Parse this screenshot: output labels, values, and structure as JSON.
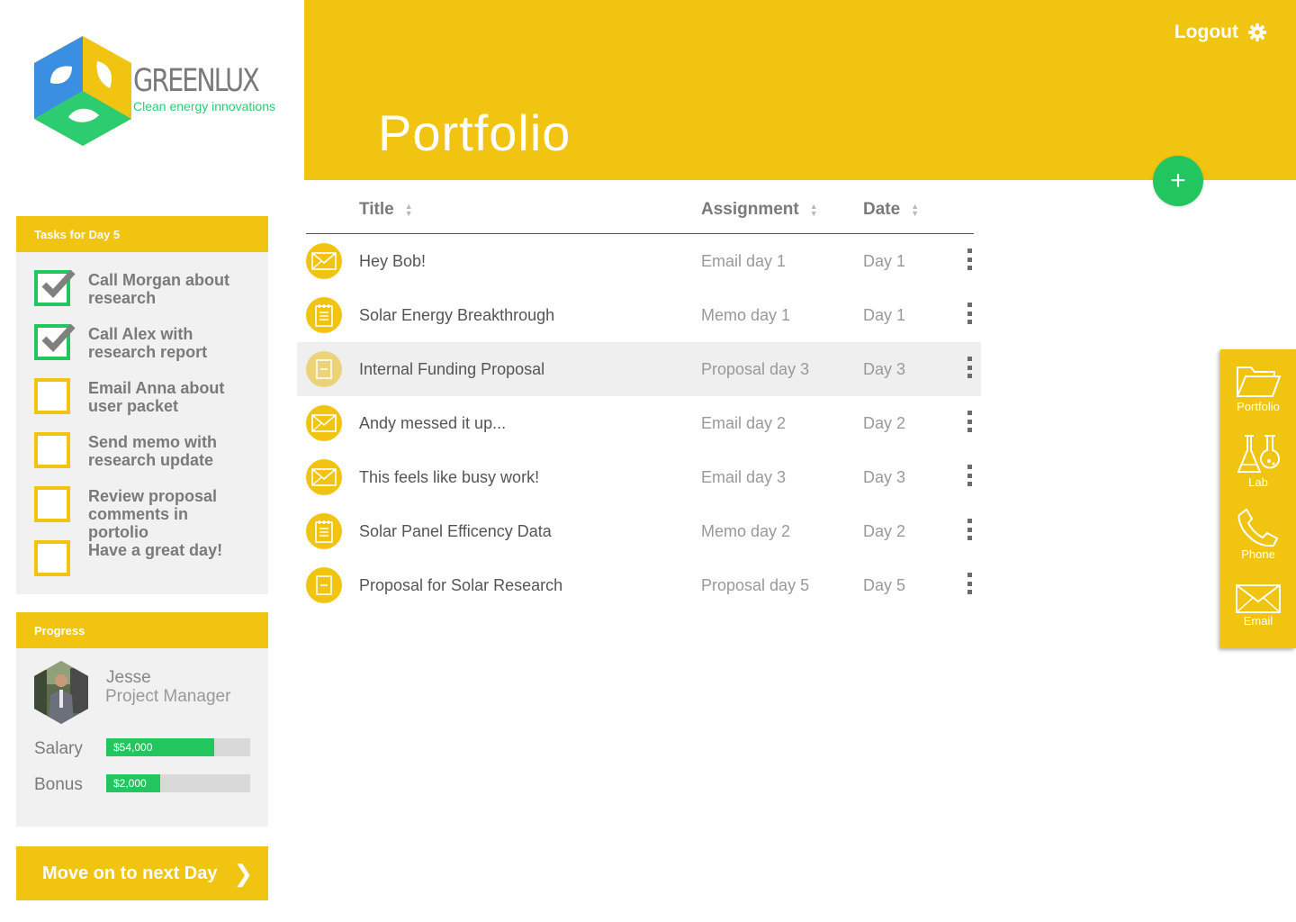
{
  "brand": {
    "name": "GREENLUX",
    "tagline": "Clean energy innovations"
  },
  "header": {
    "title": "Portfolio",
    "logout_label": "Logout"
  },
  "tasks": {
    "title": "Tasks for Day 5",
    "items": [
      {
        "label": "Call Morgan about research",
        "done": true
      },
      {
        "label": "Call Alex with research report",
        "done": true
      },
      {
        "label": "Email Anna about user packet",
        "done": false
      },
      {
        "label": "Send memo with research update",
        "done": false
      },
      {
        "label": "Review proposal comments in portolio",
        "done": false
      },
      {
        "label": "Have a great day!",
        "done": false
      }
    ]
  },
  "progress": {
    "title": "Progress",
    "name": "Jesse",
    "role": "Project Manager",
    "salary": {
      "label": "Salary",
      "value": "$54,000",
      "fraction": 0.75
    },
    "bonus": {
      "label": "Bonus",
      "value": "$2,000",
      "fraction": 0.375
    }
  },
  "next_day_label": "Move on to next Day",
  "table": {
    "columns": {
      "title": "Title",
      "assignment": "Assignment",
      "date": "Date"
    },
    "rows": [
      {
        "icon": "envelope-icon",
        "title": "Hey Bob!",
        "assignment": "Email day 1",
        "date": "Day 1"
      },
      {
        "icon": "notepad-icon",
        "title": "Solar Energy Breakthrough",
        "assignment": "Memo day 1",
        "date": "Day 1"
      },
      {
        "icon": "document-icon",
        "title": "Internal Funding Proposal",
        "assignment": "Proposal day 3",
        "date": "Day 3",
        "highlighted": true
      },
      {
        "icon": "envelope-icon",
        "title": "Andy messed it up...",
        "assignment": "Email day 2",
        "date": "Day 2"
      },
      {
        "icon": "envelope-icon",
        "title": "This feels like busy work!",
        "assignment": "Email day 3",
        "date": "Day 3"
      },
      {
        "icon": "notepad-icon",
        "title": "Solar Panel Efficency Data",
        "assignment": "Memo day 2",
        "date": "Day 2"
      },
      {
        "icon": "document-icon",
        "title": "Proposal for Solar Research",
        "assignment": "Proposal day 5",
        "date": "Day 5"
      }
    ]
  },
  "dock": {
    "items": [
      {
        "label": "Portfolio",
        "icon": "folder-icon"
      },
      {
        "label": "Lab",
        "icon": "flask-icon"
      },
      {
        "label": "Phone",
        "icon": "phone-icon"
      },
      {
        "label": "Email",
        "icon": "envelope-icon"
      }
    ]
  },
  "colors": {
    "accent": "#f0c410",
    "success": "#22c55e",
    "brand_blue": "#3b8fe0",
    "panel_bg": "#f1f1f1"
  }
}
